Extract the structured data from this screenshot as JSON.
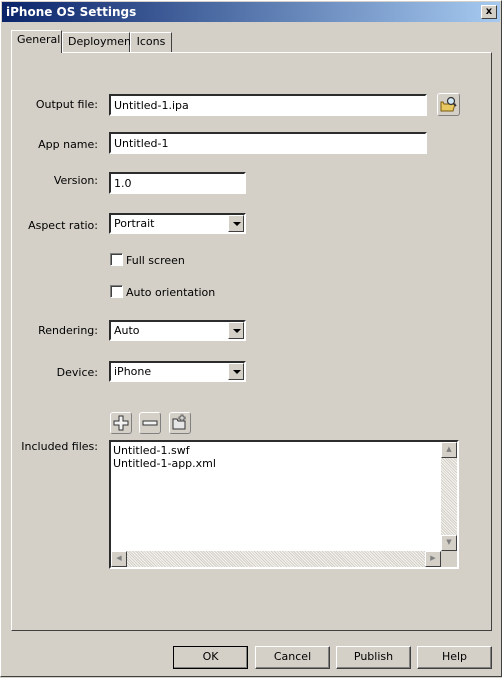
{
  "window": {
    "title": "iPhone OS Settings",
    "close_label": "x"
  },
  "tabs": [
    {
      "label": "General",
      "active": true
    },
    {
      "label": "Deployment",
      "active": false
    },
    {
      "label": "Icons",
      "active": false
    }
  ],
  "general": {
    "output_file": {
      "label": "Output file:",
      "value": "Untitled-1.ipa",
      "browse_icon": "folder-search-icon"
    },
    "app_name": {
      "label": "App name:",
      "value": "Untitled-1"
    },
    "version": {
      "label": "Version:",
      "value": "1.0"
    },
    "aspect_ratio": {
      "label": "Aspect ratio:",
      "selected": "Portrait"
    },
    "full_screen": {
      "label": "Full screen",
      "checked": false
    },
    "auto_orientation": {
      "label": "Auto orientation",
      "checked": false
    },
    "rendering": {
      "label": "Rendering:",
      "selected": "Auto"
    },
    "device": {
      "label": "Device:",
      "selected": "iPhone"
    },
    "included_files": {
      "label": "Included files:",
      "add_icon": "plus-icon",
      "remove_icon": "minus-icon",
      "add_folder_icon": "add-folder-icon",
      "items": [
        "Untitled-1.swf",
        "Untitled-1-app.xml"
      ]
    }
  },
  "buttons": {
    "ok": "OK",
    "cancel": "Cancel",
    "publish": "Publish",
    "help": "Help"
  }
}
